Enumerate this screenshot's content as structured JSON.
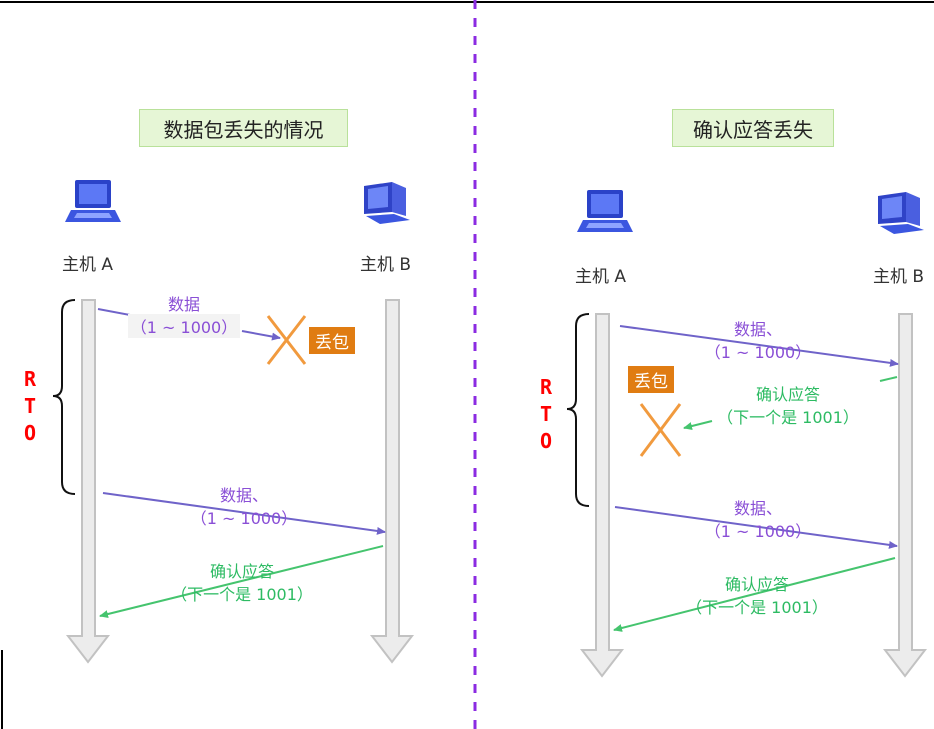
{
  "left": {
    "title": "数据包丢失的情况",
    "host_a": "主机 A",
    "host_b": "主机 B",
    "rto": [
      "R",
      "T",
      "O"
    ],
    "msg1": {
      "line1": "数据",
      "line2": "（1 ~ 1000）"
    },
    "lost": "丢包",
    "msg2": {
      "line1": "数据、",
      "line2": "（1 ~ 1000）"
    },
    "ack": {
      "line1": "确认应答",
      "line2": "（下一个是 1001）"
    }
  },
  "right": {
    "title": "确认应答丢失",
    "host_a": "主机 A",
    "host_b": "主机 B",
    "rto": [
      "R",
      "T",
      "O"
    ],
    "msg1": {
      "line1": "数据、",
      "line2": "（1 ~ 1000）"
    },
    "lost": "丢包",
    "ack1": {
      "line1": "确认应答",
      "line2": "（下一个是 1001）"
    },
    "msg2": {
      "line1": "数据、",
      "line2": "（1 ~ 1000）"
    },
    "ack2": {
      "line1": "确认应答",
      "line2": "（下一个是 1001）"
    }
  },
  "colors": {
    "data": "#7b6fc9",
    "ack": "#45c46e",
    "lost_x": "#f19a3e",
    "divider": "#8b2be2",
    "rto": "#ff0000"
  },
  "icons": {
    "host": "laptop-icon",
    "host_b": "desktop-computer-icon"
  }
}
